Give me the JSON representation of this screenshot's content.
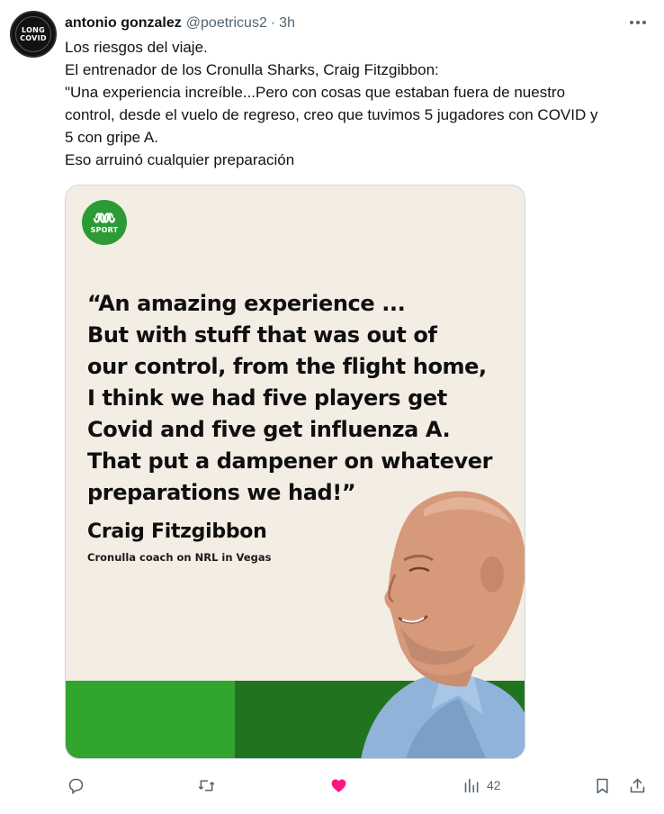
{
  "author": {
    "display_name": "antonio gonzalez",
    "handle": "@poetricus2",
    "separator": "·",
    "time": "3h",
    "avatar_text_line1": "LONG",
    "avatar_text_line2": "COVID"
  },
  "tweet": {
    "lines": [
      "Los riesgos del viaje.",
      "El entrenador de los Cronulla Sharks, Craig Fitzgibbon:",
      "\"Una experiencia increíble...Pero con cosas que estaban fuera de nuestro",
      "control, desde el vuelo de regreso, creo que tuvimos 5 jugadores con COVID y",
      "5 con gripe A.",
      "Eso arruinó cualquier preparación"
    ]
  },
  "media": {
    "logo_text": "SPORT",
    "quote_lines": [
      "“An amazing experience ...",
      "But with stuff that was out of",
      "our control, from the flight home,",
      "I think we had five players get",
      "Covid and five get influenza A.",
      "That put a dampener on whatever",
      "preparations we had!”"
    ],
    "speaker": "Craig Fitzgibbon",
    "speaker_role": "Cronulla coach on NRL in Vegas"
  },
  "actions": {
    "views_count": "42"
  },
  "colors": {
    "text_primary": "#0f1419",
    "text_secondary": "#536471",
    "like_active": "#f91880",
    "abc_green": "#2c9b35",
    "band_light": "#32a52f",
    "band_dark": "#21741f",
    "card_bg": "#f3ede4"
  },
  "icons": [
    "reply-icon",
    "retweet-icon",
    "like-icon",
    "views-icon",
    "bookmark-icon",
    "share-icon",
    "more-icon"
  ]
}
